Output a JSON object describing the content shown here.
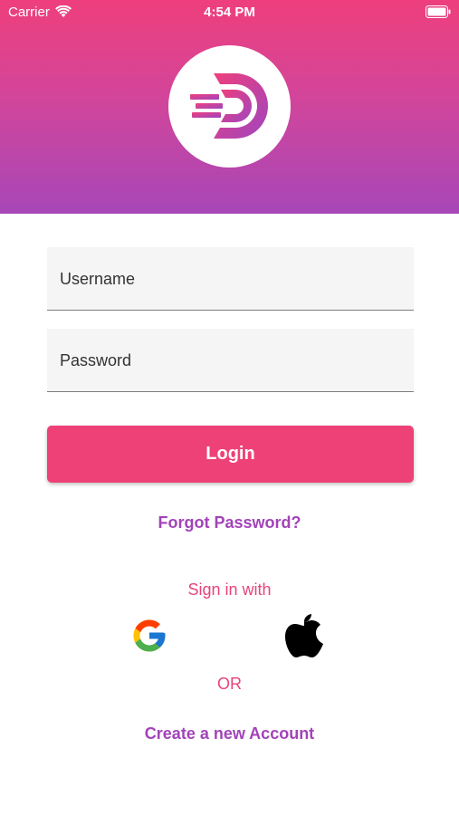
{
  "status_bar": {
    "carrier": "Carrier",
    "time": "4:54 PM"
  },
  "header": {
    "logo": "d-logo-icon"
  },
  "form": {
    "username_placeholder": "Username",
    "password_placeholder": "Password",
    "username_value": "",
    "password_value": "",
    "login_label": "Login",
    "forgot_password": "Forgot Password?"
  },
  "social": {
    "sign_in_with": "Sign in with",
    "providers": [
      "google-icon",
      "apple-icon"
    ],
    "or_text": "OR",
    "create_account": "Create a new Account"
  },
  "colors": {
    "accent_pink": "#ee4178",
    "accent_purple": "#a243b8"
  }
}
